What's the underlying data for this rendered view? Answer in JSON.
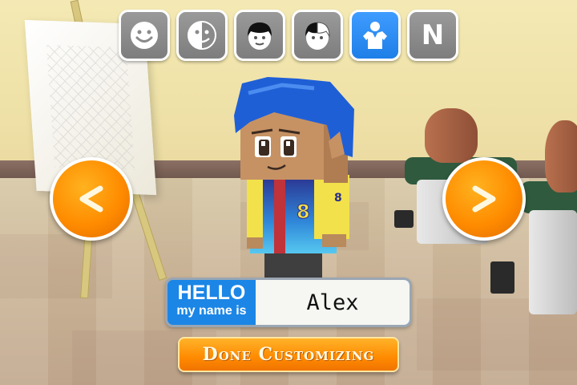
{
  "tabs": [
    {
      "id": "face",
      "icon": "smiley-face-icon",
      "active": false
    },
    {
      "id": "skin",
      "icon": "face-color-split-icon",
      "active": false
    },
    {
      "id": "hair",
      "icon": "head-hair-icon",
      "active": false
    },
    {
      "id": "hair-color",
      "icon": "hair-color-split-icon",
      "active": false
    },
    {
      "id": "shirt",
      "icon": "shirt-person-icon",
      "active": true
    },
    {
      "id": "name",
      "label": "N",
      "active": false
    }
  ],
  "nav": {
    "prev_icon": "chevron-left-icon",
    "next_icon": "chevron-right-icon"
  },
  "character": {
    "hair_color": "#1f5fd6",
    "jersey_number": "8",
    "jersey_colors": [
      "#2b2f8c",
      "#3ba2e6",
      "#f2e14a"
    ]
  },
  "nametag": {
    "hello": "HELLO",
    "subtitle": "my name is",
    "name": "Alex"
  },
  "done_button": {
    "label": "Done Customizing"
  },
  "colors": {
    "accent_orange": "#ff8c00",
    "active_tab_blue": "#1e7fe8",
    "tab_gray": "#8a8a8a",
    "nametag_blue": "#1b86e6"
  }
}
